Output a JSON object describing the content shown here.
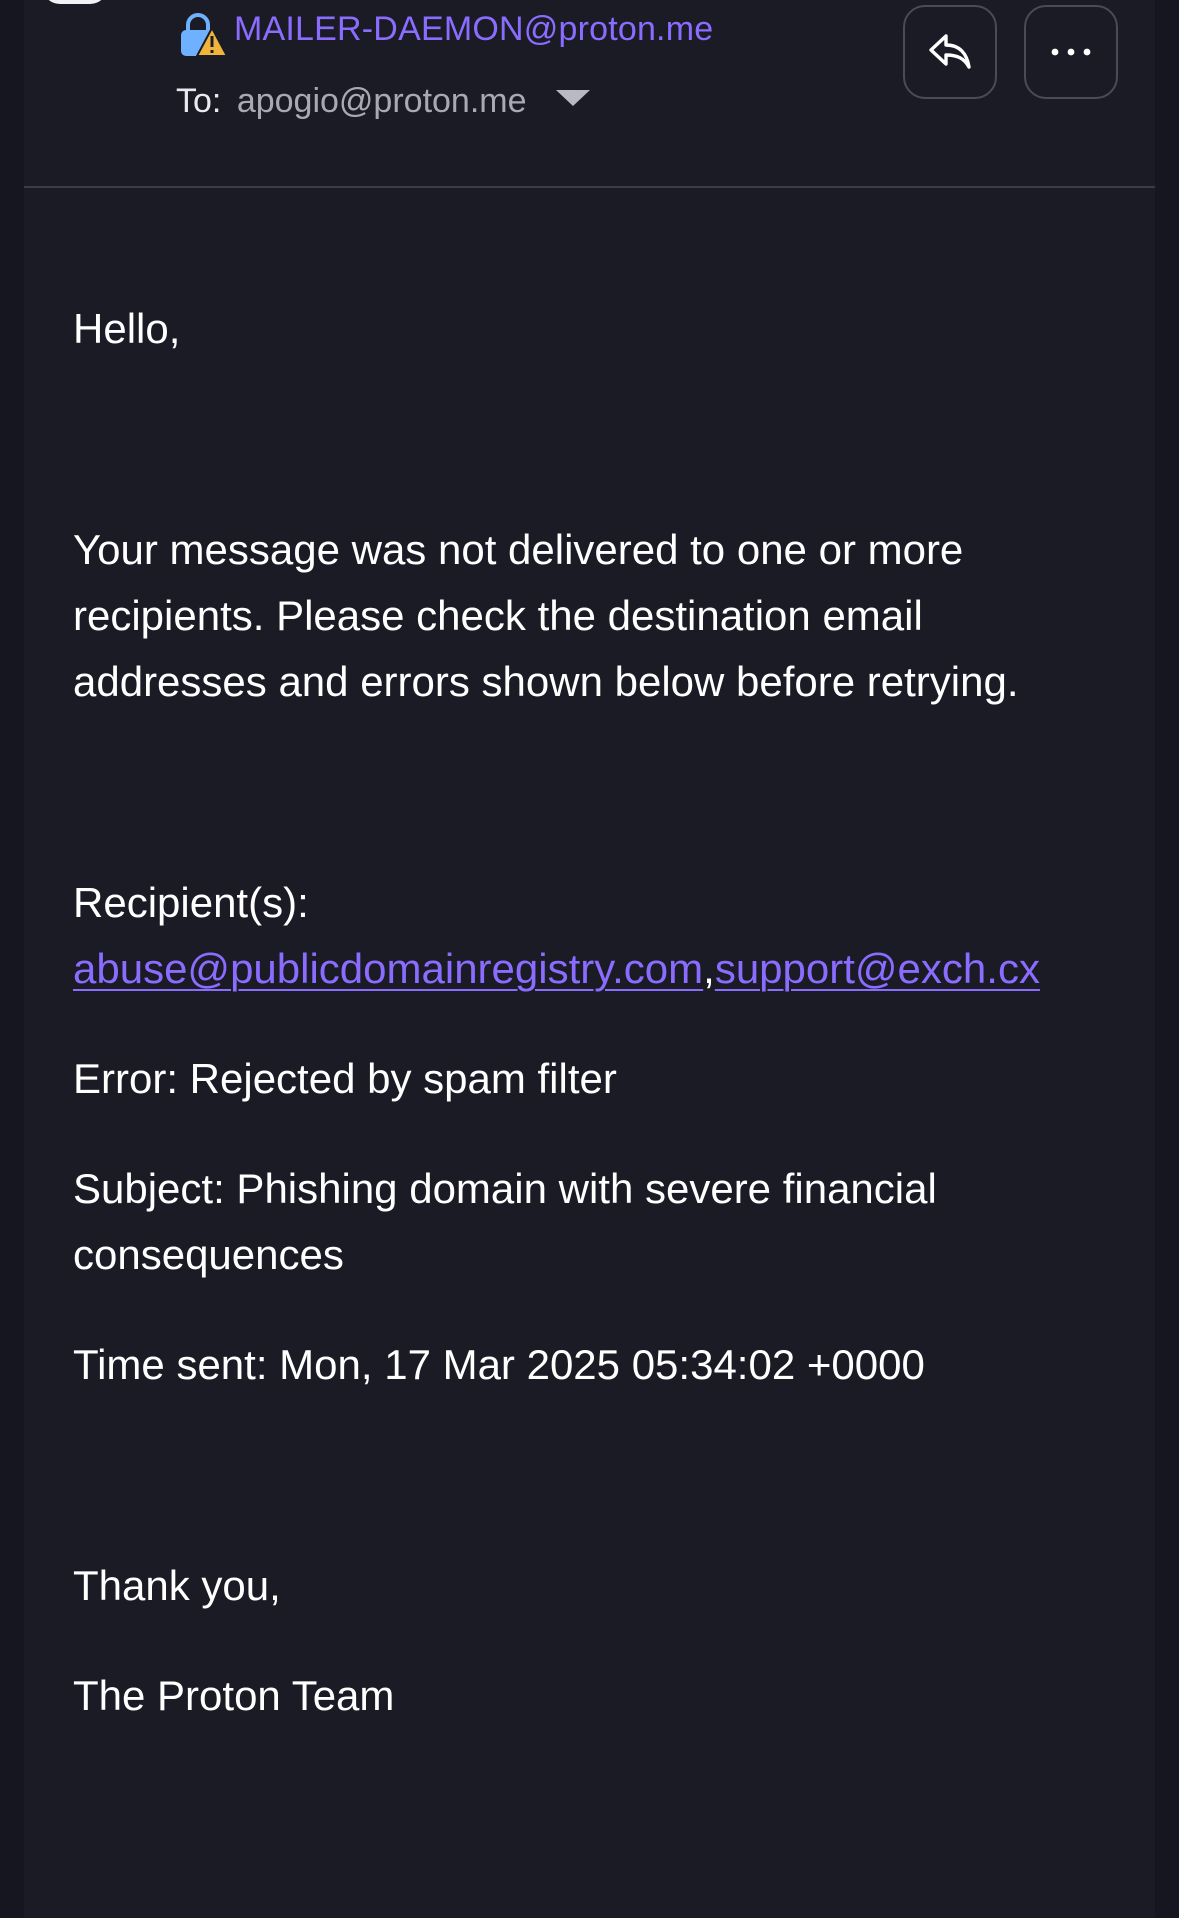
{
  "header": {
    "sender": "MAILER-DAEMON@proton.me",
    "to_label": "To:",
    "to_value": "apogio@proton.me",
    "icons": {
      "lock": "lock-warning-icon",
      "caret": "caret-down-icon",
      "reply": "reply-icon",
      "more": "more-horizontal-icon"
    },
    "colors": {
      "accent": "#8a6cff",
      "lock": "#6fb1ff",
      "warning": "#f0b43a",
      "background": "#1b1b26"
    }
  },
  "message": {
    "greeting": "Hello,",
    "intro": "Your message was not delivered to one or more recipients. Please check the destination email addresses and errors shown below before retrying.",
    "recipients_label": "Recipient(s):",
    "recipient_1": "abuse@publicdomainregistry.com",
    "separator": ",",
    "recipient_2": "support@exch.cx",
    "error": "Error: Rejected by spam filter",
    "subject": "Subject: Phishing domain with severe financial consequences",
    "time_sent": "Time sent: Mon, 17 Mar 2025 05:34:02 +0000",
    "closing": "Thank you,",
    "signature": "The Proton Team"
  }
}
